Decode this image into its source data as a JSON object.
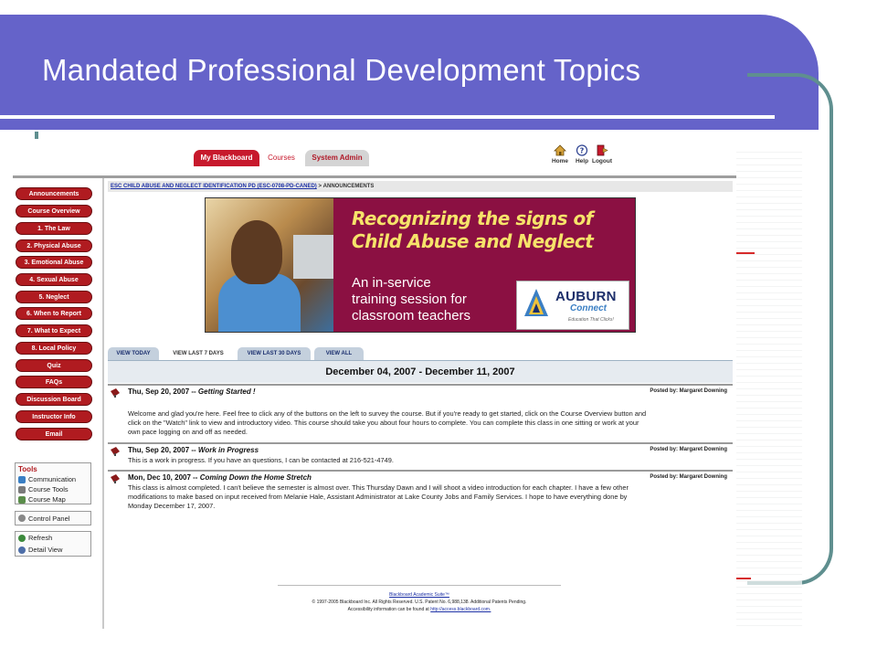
{
  "slide": {
    "title": "Mandated Professional Development Topics",
    "accent_color": "#6563c9",
    "frame_color": "#5f8f8f"
  },
  "topbar": {
    "tabs": [
      {
        "label": "My Blackboard",
        "active": true
      },
      {
        "label": "Courses",
        "active": false
      },
      {
        "label": "System Admin",
        "active": false
      }
    ],
    "icons": [
      {
        "icon": "home-icon",
        "label": "Home"
      },
      {
        "icon": "help-icon",
        "label": "Help"
      },
      {
        "icon": "logout-icon",
        "label": "Logout"
      }
    ]
  },
  "nav": {
    "buttons": [
      "Announcements",
      "Course Overview",
      "1. The Law",
      "2. Physical Abuse",
      "3. Emotional Abuse",
      "4. Sexual Abuse",
      "5. Neglect",
      "6. When to Report",
      "7. What to Expect",
      "8. Local Policy",
      "Quiz",
      "FAQs",
      "Discussion Board",
      "Instructor Info",
      "Email"
    ],
    "button_color": "#b01b20",
    "tools_title": "Tools",
    "tools": [
      {
        "icon": "communication-icon",
        "label": "Communication"
      },
      {
        "icon": "course-tools-icon",
        "label": "Course Tools"
      },
      {
        "icon": "course-map-icon",
        "label": "Course Map"
      }
    ],
    "control_panel": "Control Panel",
    "refresh": "Refresh",
    "detail_view": "Detail View"
  },
  "breadcrumb": {
    "course": "ESC CHILD ABUSE AND NEGLECT IDENTIFICATION PD (ESC-0708-PD-CANED)",
    "separator": ">",
    "current": "ANNOUNCEMENTS"
  },
  "banner": {
    "headline_line1": "Recognizing the signs of",
    "headline_line2": "Child Abuse and Neglect",
    "sub_line1": "An in-service",
    "sub_line2": "training session for",
    "sub_line3": "classroom teachers",
    "logo_name": "AUBURN",
    "logo_connect": "Connect",
    "logo_tagline": "Education That Clicks!",
    "bg_color": "#8b1042"
  },
  "view_tabs": [
    {
      "label": "VIEW TODAY",
      "active": false
    },
    {
      "label": "VIEW LAST 7 DAYS",
      "active": true
    },
    {
      "label": "VIEW LAST 30 DAYS",
      "active": false
    },
    {
      "label": "VIEW ALL",
      "active": false
    }
  ],
  "date_range": "December 04, 2007 - December 11, 2007",
  "announcements": [
    {
      "date": "Thu, Sep 20, 2007 -- ",
      "subject": "Getting Started !",
      "posted_by": "Posted by: Margaret Downing",
      "body": "Welcome and glad you're here.  Feel free to click any of the buttons on the left to survey the course.  But if you're ready to get started, click on the Course Overview button and click on the \"Watch\" link to view and introductory video.  This course should take you about four hours to complete.  You can complete this class in one sitting or work at your own pace logging on and off as needed."
    },
    {
      "date": "Thu, Sep 20, 2007 -- ",
      "subject": "Work in Progress",
      "posted_by": "Posted by: Margaret Downing",
      "body": "This is a work in progress.  If you have an questions, I can be contacted at 216-521-4749."
    },
    {
      "date": "Mon, Dec 10, 2007 -- ",
      "subject": "Coming Down the Home Stretch",
      "posted_by": "Posted by: Margaret Downing",
      "body": "This class is almost completed.  I can't believe the semester is almost over.  This Thursday Dawn and I will shoot a video introduction for each chapter.  I have a few other modifications to make based on input received from Melanie Hale, Assistant Administrator at Lake County Jobs and Family Services.  I hope to have everything done by Monday December 17, 2007."
    }
  ],
  "footer": {
    "suite_link": "Blackboard Academic Suite™",
    "copyright": "© 1997-2005 Blackboard Inc. All Rights Reserved. U.S. Patent No. 6,988,138. Additional Patents Pending.",
    "accessibility_text": "Accessibility information can be found at ",
    "accessibility_link": "http://access.blackboard.com."
  }
}
